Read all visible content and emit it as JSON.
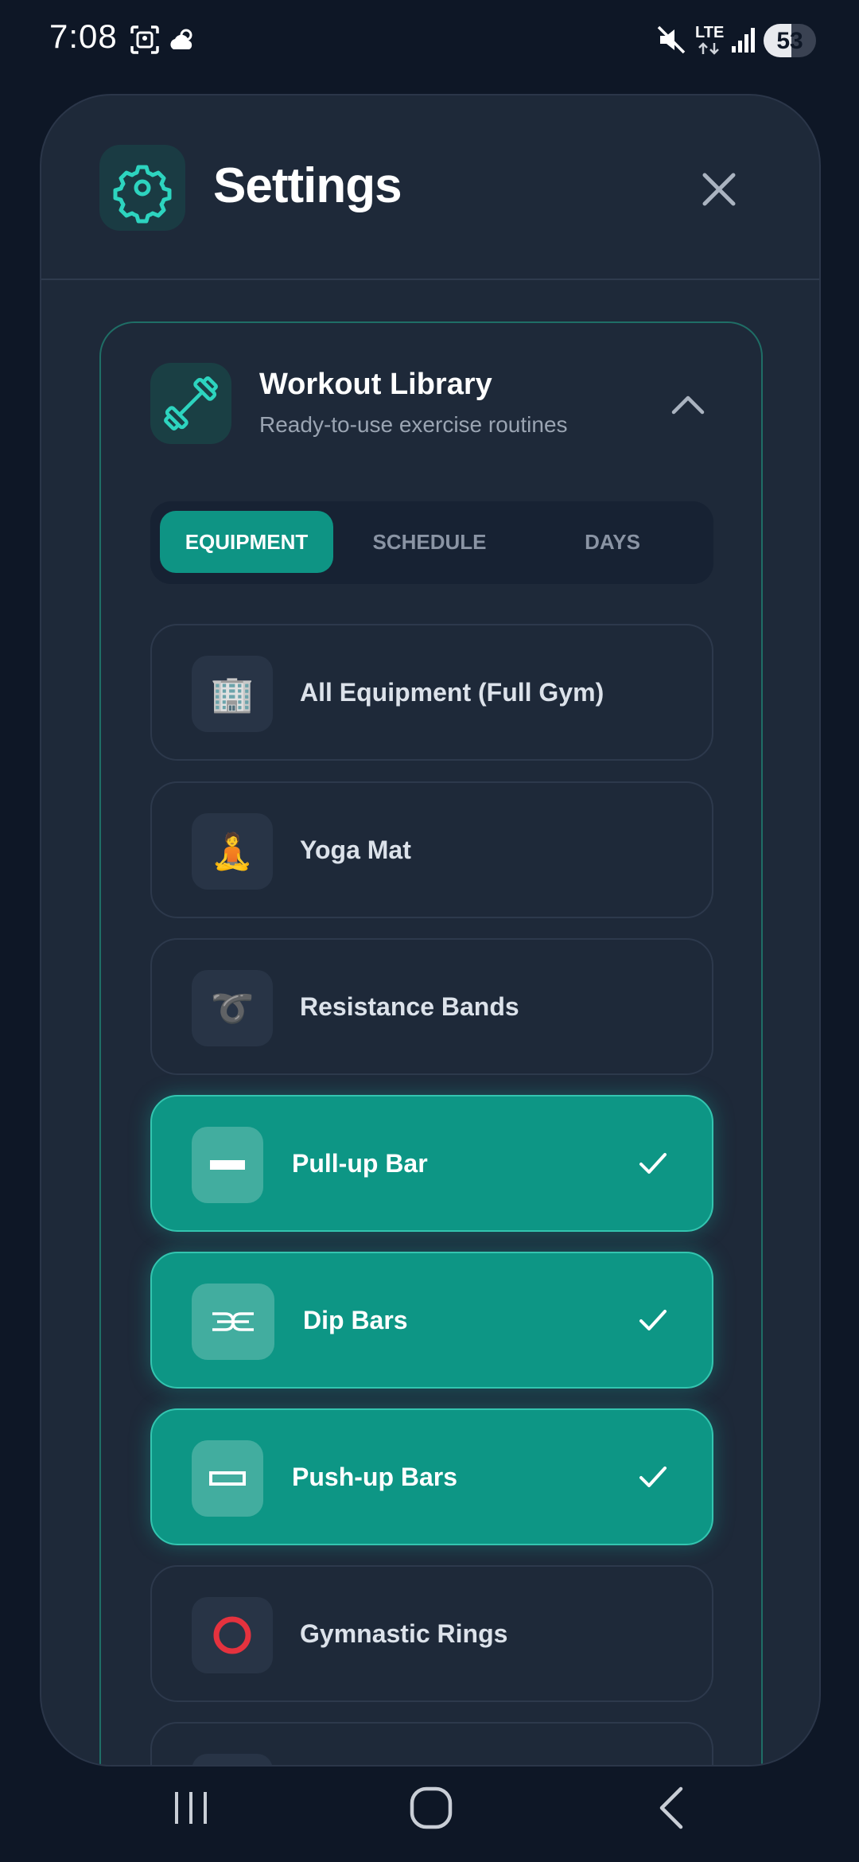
{
  "status_bar": {
    "time": "7:08",
    "network": "LTE",
    "battery": "53",
    "battery_level": 53
  },
  "modal": {
    "title": "Settings",
    "title_icon": "gear-icon",
    "close_icon": "close-icon"
  },
  "library": {
    "title": "Workout Library",
    "subtitle": "Ready-to-use exercise routines",
    "icon": "dumbbell-icon",
    "tabs": [
      {
        "label": "EQUIPMENT",
        "active": true
      },
      {
        "label": "SCHEDULE",
        "active": false
      },
      {
        "label": "DAYS",
        "active": false
      }
    ],
    "items": [
      {
        "label": "All Equipment (Full Gym)",
        "icon": "🏢",
        "icon_name": "building-icon",
        "selected": false
      },
      {
        "label": "Yoga Mat",
        "icon": "🧘",
        "icon_name": "yoga-icon",
        "selected": false
      },
      {
        "label": "Resistance Bands",
        "icon": "➰",
        "icon_name": "loop-icon",
        "selected": false
      },
      {
        "label": "Pull-up Bar",
        "icon": "▬",
        "icon_name": "bar-icon",
        "selected": true
      },
      {
        "label": "Dip Bars",
        "icon": "⫘",
        "icon_name": "dip-bars-icon",
        "selected": true
      },
      {
        "label": "Push-up Bars",
        "icon": "▭",
        "icon_name": "push-up-bars-icon",
        "selected": true
      },
      {
        "label": "Gymnastic Rings",
        "icon": "⭕",
        "icon_name": "ring-icon",
        "selected": false
      }
    ]
  },
  "colors": {
    "accent": "#0d9685",
    "background": "#0e1726",
    "panel": "#1e2939"
  }
}
